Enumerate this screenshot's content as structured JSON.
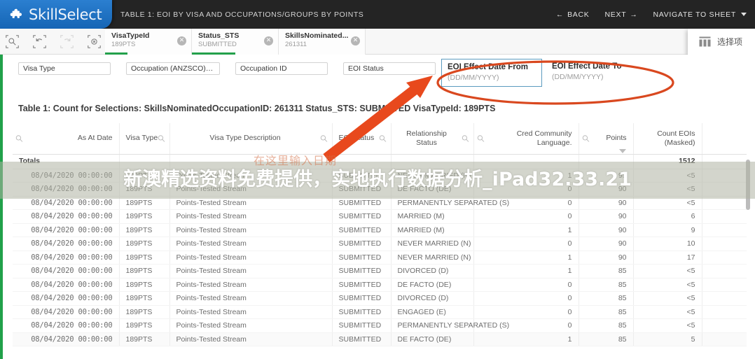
{
  "topbar": {
    "logo_text": "SkillSelect",
    "title": "TABLE 1: EOI BY VISA AND OCCUPATIONS/GROUPS BY POINTS",
    "back_label": "BACK",
    "next_label": "NEXT",
    "navigate_label": "NAVIGATE TO SHEET",
    "back_arrow": "←",
    "next_arrow": "→"
  },
  "selection_bar": {
    "tools": [
      {
        "name": "selections-search-icon",
        "title": "Selections search"
      },
      {
        "name": "step-back-icon",
        "title": "Step back"
      },
      {
        "name": "step-forward-icon",
        "title": "Step forward"
      },
      {
        "name": "clear-all-selections-icon",
        "title": "Clear all selections"
      }
    ],
    "chips": [
      {
        "title": "VisaTypeId",
        "value": "189PTS",
        "green_pct": 26
      },
      {
        "title": "Status_STS",
        "value": "SUBMITTED",
        "green_pct": 50
      },
      {
        "title": "SkillsNominated...",
        "value": "261311",
        "green_pct": 0
      }
    ],
    "clear_glyph": "✕",
    "right_label": "选择项"
  },
  "filters": {
    "boxes": [
      {
        "label": "Visa Type"
      },
      {
        "label": "Occupation (ANZSCO)…"
      },
      {
        "label": "Occupation ID"
      },
      {
        "label": "EOI Status"
      }
    ],
    "date_from": {
      "label": "EOI Effect Date From",
      "placeholder": "(DD/MM/YYYY)",
      "value": ""
    },
    "date_to": {
      "label": "EOI Effect Date To",
      "placeholder": "(DD/MM/YYYY)",
      "value": ""
    }
  },
  "table": {
    "title": "Table 1: Count for Selections: SkillsNominatedOccupationID: 261311 Status_STS: SUBMITTED VisaTypeId: 189PTS",
    "headers": [
      {
        "label": "As At Date",
        "align": "right"
      },
      {
        "label": "Visa Type",
        "align": "left"
      },
      {
        "label": "Visa Type Description",
        "align": "left"
      },
      {
        "label": "EOI Status",
        "align": "left"
      },
      {
        "label": "Relationship Status",
        "align": "left"
      },
      {
        "label": "Cred Community Language.",
        "align": "right"
      },
      {
        "label": "Points",
        "align": "right"
      },
      {
        "label": "Count EOIs (Masked)",
        "align": "right"
      },
      {
        "label": "",
        "align": "left"
      }
    ],
    "totals_label": "Totals",
    "totals_count": "1512",
    "rows": [
      {
        "as_at_date": "08/04/2020 00:00:00",
        "visa_type": "189PTS",
        "visa_desc": "Points-Tested Stream",
        "eoi_status": "SUBMITTED",
        "relationship": "NEVER MARRIED (N)",
        "ccl": "1",
        "points": "95",
        "count": "<5"
      },
      {
        "as_at_date": "08/04/2020 00:00:00",
        "visa_type": "189PTS",
        "visa_desc": "Points-Tested Stream",
        "eoi_status": "SUBMITTED",
        "relationship": "DE FACTO (DE)",
        "ccl": "0",
        "points": "90",
        "count": "<5"
      },
      {
        "as_at_date": "08/04/2020 00:00:00",
        "visa_type": "189PTS",
        "visa_desc": "Points-Tested Stream",
        "eoi_status": "SUBMITTED",
        "relationship": "PERMANENTLY SEPARATED (S)",
        "ccl": "0",
        "points": "90",
        "count": "<5"
      },
      {
        "as_at_date": "08/04/2020 00:00:00",
        "visa_type": "189PTS",
        "visa_desc": "Points-Tested Stream",
        "eoi_status": "SUBMITTED",
        "relationship": "MARRIED (M)",
        "ccl": "0",
        "points": "90",
        "count": "6"
      },
      {
        "as_at_date": "08/04/2020 00:00:00",
        "visa_type": "189PTS",
        "visa_desc": "Points-Tested Stream",
        "eoi_status": "SUBMITTED",
        "relationship": "MARRIED (M)",
        "ccl": "1",
        "points": "90",
        "count": "9"
      },
      {
        "as_at_date": "08/04/2020 00:00:00",
        "visa_type": "189PTS",
        "visa_desc": "Points-Tested Stream",
        "eoi_status": "SUBMITTED",
        "relationship": "NEVER MARRIED (N)",
        "ccl": "0",
        "points": "90",
        "count": "10"
      },
      {
        "as_at_date": "08/04/2020 00:00:00",
        "visa_type": "189PTS",
        "visa_desc": "Points-Tested Stream",
        "eoi_status": "SUBMITTED",
        "relationship": "NEVER MARRIED (N)",
        "ccl": "1",
        "points": "90",
        "count": "17"
      },
      {
        "as_at_date": "08/04/2020 00:00:00",
        "visa_type": "189PTS",
        "visa_desc": "Points-Tested Stream",
        "eoi_status": "SUBMITTED",
        "relationship": "DIVORCED (D)",
        "ccl": "1",
        "points": "85",
        "count": "<5"
      },
      {
        "as_at_date": "08/04/2020 00:00:00",
        "visa_type": "189PTS",
        "visa_desc": "Points-Tested Stream",
        "eoi_status": "SUBMITTED",
        "relationship": "DE FACTO (DE)",
        "ccl": "0",
        "points": "85",
        "count": "<5"
      },
      {
        "as_at_date": "08/04/2020 00:00:00",
        "visa_type": "189PTS",
        "visa_desc": "Points-Tested Stream",
        "eoi_status": "SUBMITTED",
        "relationship": "DIVORCED (D)",
        "ccl": "0",
        "points": "85",
        "count": "<5"
      },
      {
        "as_at_date": "08/04/2020 00:00:00",
        "visa_type": "189PTS",
        "visa_desc": "Points-Tested Stream",
        "eoi_status": "SUBMITTED",
        "relationship": "ENGAGED (E)",
        "ccl": "0",
        "points": "85",
        "count": "<5"
      },
      {
        "as_at_date": "08/04/2020 00:00:00",
        "visa_type": "189PTS",
        "visa_desc": "Points-Tested Stream",
        "eoi_status": "SUBMITTED",
        "relationship": "PERMANENTLY SEPARATED (S)",
        "ccl": "0",
        "points": "85",
        "count": "<5"
      },
      {
        "as_at_date": "08/04/2020 00:00:00",
        "visa_type": "189PTS",
        "visa_desc": "Points-Tested Stream",
        "eoi_status": "SUBMITTED",
        "relationship": "DE FACTO (DE)",
        "ccl": "1",
        "points": "85",
        "count": "5"
      }
    ]
  },
  "annotations": {
    "chinese_hint": "在这里输入日期",
    "watermark": "新澳精选资料免费提供，实地执行数据分析_iPad32.33.21",
    "highlight_color": "#d9481f"
  }
}
